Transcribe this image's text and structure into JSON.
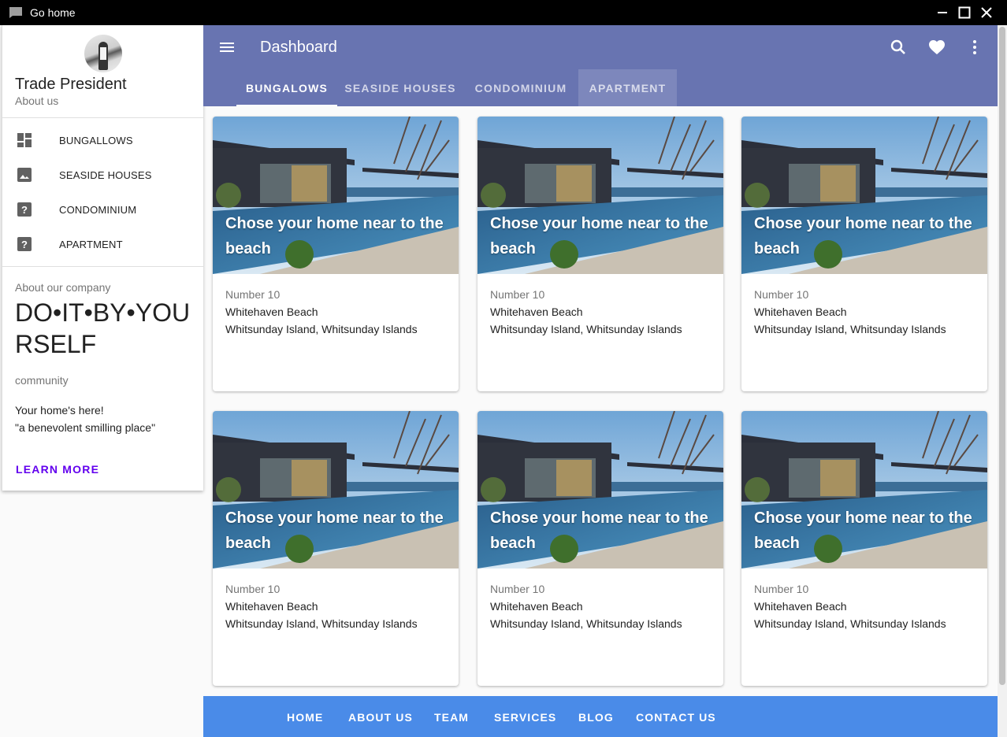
{
  "window": {
    "title": "Go home",
    "icons": [
      "chat-icon",
      "minimize-icon",
      "maximize-icon",
      "close-icon"
    ]
  },
  "sidebar": {
    "brand_name": "Trade President",
    "brand_sub": "About us",
    "items": [
      {
        "label": "BUNGALLOWS",
        "icon": "dashboard-icon"
      },
      {
        "label": "SEASIDE HOUSES",
        "icon": "image-icon"
      },
      {
        "label": "CONDOMINIUM",
        "icon": "help-icon"
      },
      {
        "label": "APARTMENT",
        "icon": "help-icon"
      }
    ],
    "about": {
      "heading": "About our company",
      "title": "DO•IT•BY•YOURSELF",
      "community": "community",
      "text1": "Your home's here!",
      "text2": "\"a benevolent smilling place\"",
      "learn_more": "LEARN MORE"
    }
  },
  "appbar": {
    "title": "Dashboard",
    "tabs": [
      {
        "label": "BUNGALOWS",
        "active": true
      },
      {
        "label": "SEASIDE HOUSES",
        "active": false
      },
      {
        "label": "CONDOMINIUM",
        "active": false
      },
      {
        "label": "APARTMENT",
        "active": false
      }
    ],
    "actions": [
      "search-icon",
      "favorite-icon",
      "more-vert-icon"
    ],
    "color": "#6874b1"
  },
  "cards": [
    {
      "media_title": "Chose your home near to the beach",
      "subtitle": "Number 10",
      "line1": "Whitehaven Beach",
      "line2": "Whitsunday Island, Whitsunday Islands"
    },
    {
      "media_title": "Chose your home near to the beach",
      "subtitle": "Number 10",
      "line1": "Whitehaven Beach",
      "line2": "Whitsunday Island, Whitsunday Islands"
    },
    {
      "media_title": "Chose your home near to the beach",
      "subtitle": "Number 10",
      "line1": "Whitehaven Beach",
      "line2": "Whitsunday Island, Whitsunday Islands"
    },
    {
      "media_title": "Chose your home near to the beach",
      "subtitle": "Number 10",
      "line1": "Whitehaven Beach",
      "line2": "Whitsunday Island, Whitsunday Islands"
    },
    {
      "media_title": "Chose your home near to the beach",
      "subtitle": "Number 10",
      "line1": "Whitehaven Beach",
      "line2": "Whitsunday Island, Whitsunday Islands"
    },
    {
      "media_title": "Chose your home near to the beach",
      "subtitle": "Number 10",
      "line1": "Whitehaven Beach",
      "line2": "Whitsunday Island, Whitsunday Islands"
    }
  ],
  "footer": {
    "links": [
      "HOME",
      "ABOUT US",
      "TEAM",
      "SERVICES",
      "BLOG",
      "CONTACT US"
    ],
    "color": "#4a8be8"
  },
  "colors": {
    "accent_link": "#6200ee"
  }
}
